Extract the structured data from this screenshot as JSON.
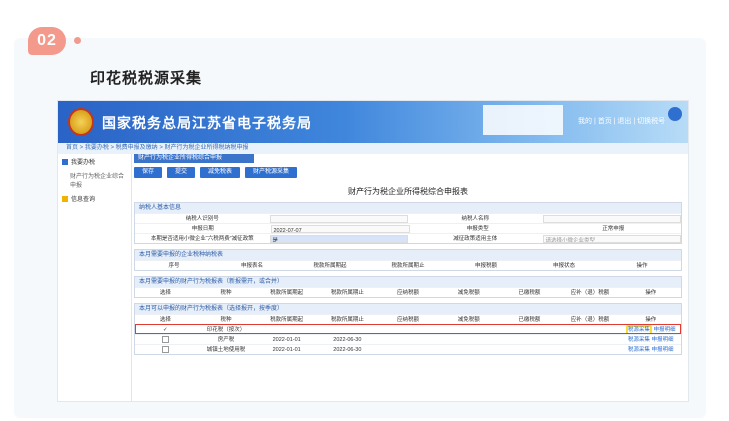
{
  "step_badge": "02",
  "section_title": "印花税税源采集",
  "colors": {
    "accent": "#f49a8d",
    "primary": "#2f6fcf",
    "highlight": "#e23a2e",
    "yellow": "#f4df3a"
  },
  "banner": {
    "title": "国家税务总局江苏省电子税务局",
    "links": "我的 | 首页 | 退出 | 切换税号"
  },
  "breadcrumb": "首页 > 我要办税 > 税费申报及缴纳 > 财产行为税企业所得税纳税申报",
  "sidebar": {
    "items": [
      {
        "label": "我要办税",
        "icon": "doc-icon"
      },
      {
        "label": "财产行为税企业综合申报",
        "sub": true
      },
      {
        "label": "信息查询",
        "icon": "folder-icon"
      }
    ]
  },
  "tab_label": "财产行为税企业所得税综合申报",
  "buttons": [
    "保存",
    "提交",
    "减免税表",
    "财产税源采集"
  ],
  "form_title": "财产行为税企业所得税综合申报表",
  "panel1": {
    "header": "纳税人基本信息",
    "rows": [
      [
        "纳税人识别号",
        "",
        "纳税人名称",
        ""
      ],
      [
        "申报日期",
        "2022-07-07",
        "申报类型",
        "正常申报"
      ],
      [
        "本期是否适用小微企业“六税两费”减征政策",
        "是",
        "减征政策适用主体",
        "请选择小微企业类型"
      ]
    ]
  },
  "panel2": {
    "header": "本月需要申报的企业税种纳税表",
    "columns": [
      "序号",
      "申报表名",
      "税款所属期起",
      "税款所属期止",
      "申报税额",
      "申报状态",
      "操作"
    ]
  },
  "panel3": {
    "header": "本月需要申报的财产行为税报表（新报需开，或合并）",
    "columns": [
      "选择",
      "税种",
      "税款所属期起",
      "税款所属期止",
      "应纳税额",
      "减免税额",
      "已缴税额",
      "应补（退）税额",
      "操作"
    ]
  },
  "panel4": {
    "header": "本月可以申报的财产行为税报表（选择报开，按季度）",
    "columns": [
      "选择",
      "税种",
      "税款所属期起",
      "税款所属期止",
      "应纳税额",
      "减免税额",
      "已缴税额",
      "应补（退）税额",
      "操作"
    ],
    "rows": [
      {
        "name": "印花税（按次）",
        "start": "",
        "end": "",
        "actions": [
          "税源采集",
          "申报明细"
        ],
        "checked": true,
        "highlight": true
      },
      {
        "name": "房产税",
        "start": "2022-01-01",
        "end": "2022-06-30",
        "actions": [
          "税源采集",
          "申报明细"
        ],
        "checked": false
      },
      {
        "name": "城镇土地使用税",
        "start": "2022-01-01",
        "end": "2022-06-30",
        "actions": [
          "税源采集",
          "申报明细"
        ],
        "checked": false
      }
    ]
  }
}
